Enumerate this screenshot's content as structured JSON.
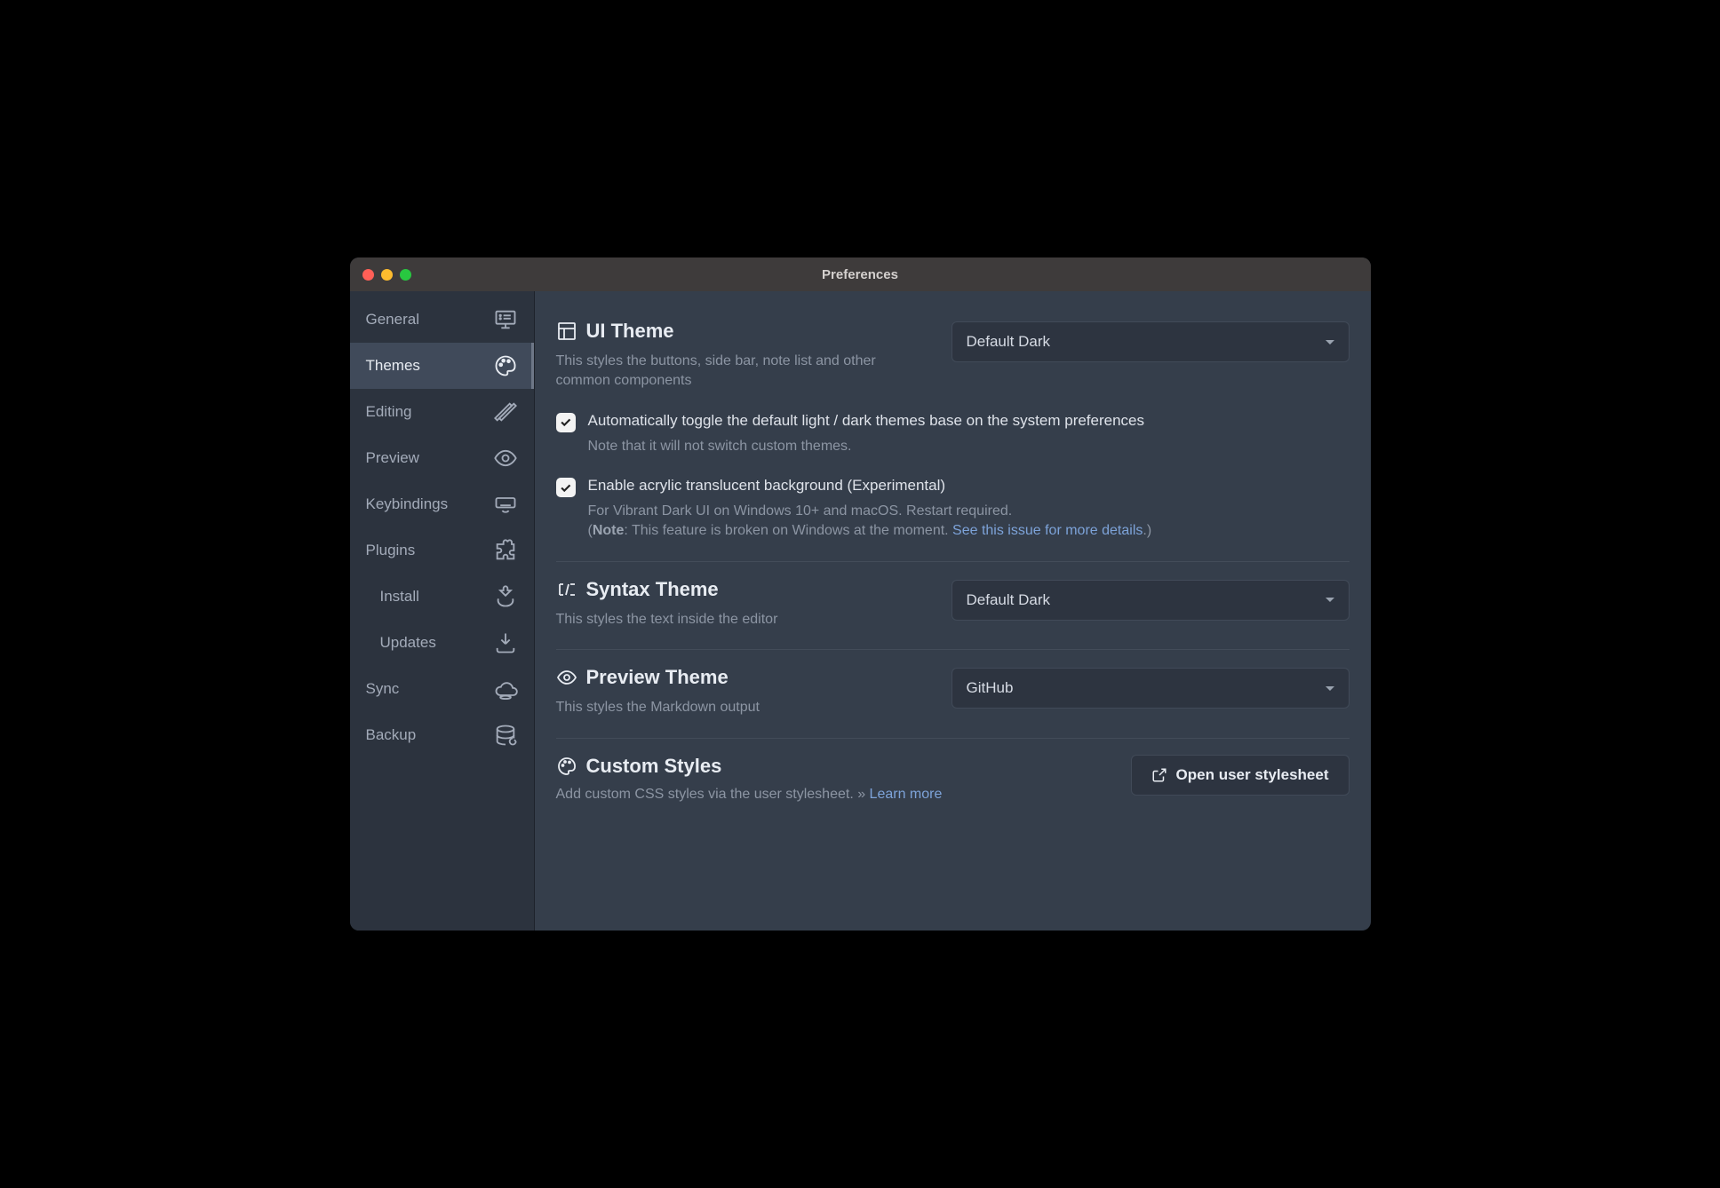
{
  "window": {
    "title": "Preferences"
  },
  "sidebar": {
    "items": [
      {
        "label": "General"
      },
      {
        "label": "Themes"
      },
      {
        "label": "Editing"
      },
      {
        "label": "Preview"
      },
      {
        "label": "Keybindings"
      },
      {
        "label": "Plugins"
      },
      {
        "label": "Install"
      },
      {
        "label": "Updates"
      },
      {
        "label": "Sync"
      },
      {
        "label": "Backup"
      }
    ]
  },
  "ui_theme": {
    "title": "UI Theme",
    "description": "This styles the buttons, side bar, note list and other common components",
    "selected": "Default Dark",
    "auto_toggle": {
      "checked": true,
      "label": "Automatically toggle the default light / dark themes base on the system preferences",
      "note": "Note that it will not switch custom themes."
    },
    "acrylic": {
      "checked": true,
      "label": "Enable acrylic translucent background (Experimental)",
      "note_prefix": "For Vibrant Dark UI on Windows 10+ and macOS. Restart required.",
      "note_bold": "Note",
      "note_mid": ": This feature is broken on Windows at the moment. ",
      "note_link": "See this issue for more details",
      "note_suffix": ".)"
    }
  },
  "syntax_theme": {
    "title": "Syntax Theme",
    "description": "This styles the text inside the editor",
    "selected": "Default Dark"
  },
  "preview_theme": {
    "title": "Preview Theme",
    "description": "This styles the Markdown output",
    "selected": "GitHub"
  },
  "custom_styles": {
    "title": "Custom Styles",
    "description": "Add custom CSS styles via the user stylesheet. » ",
    "learn_more": "Learn more",
    "button": "Open user stylesheet"
  }
}
